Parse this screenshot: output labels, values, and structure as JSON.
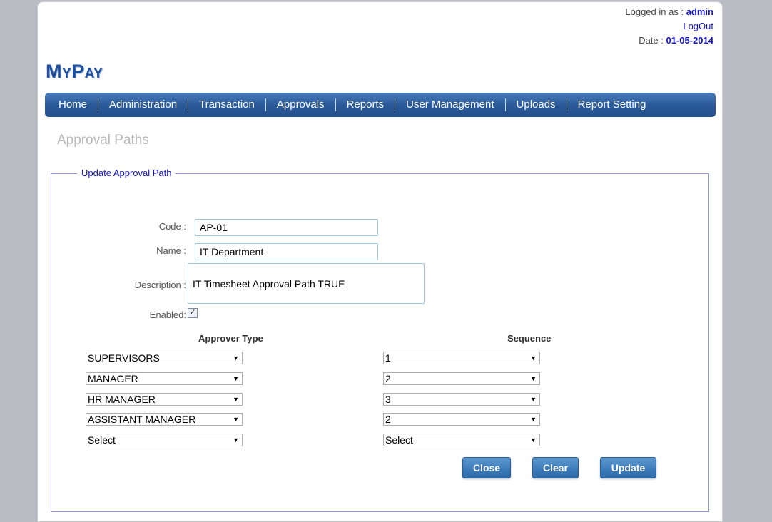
{
  "header": {
    "logged_in_label": "Logged in as :",
    "username": "admin",
    "logout": "LogOut",
    "date_label": "Date :",
    "date_value": "01-05-2014",
    "logo": "MyPay"
  },
  "nav": {
    "items": [
      "Home",
      "Administration",
      "Transaction",
      "Approvals",
      "Reports",
      "User Management",
      "Uploads",
      "Report Setting"
    ]
  },
  "page": {
    "title": "Approval Paths"
  },
  "form": {
    "legend": "Update Approval Path",
    "code_label": "Code :",
    "code_value": "AP-01",
    "name_label": "Name :",
    "name_value": "IT Department",
    "description_label": "Description :",
    "description_value": "IT Timesheet Approval Path TRUE",
    "enabled_label": "Enabled:",
    "enabled": true,
    "approver_type_header": "Approver Type",
    "sequence_header": "Sequence",
    "rows": [
      {
        "approver": "SUPERVISORS",
        "sequence": "1"
      },
      {
        "approver": "MANAGER",
        "sequence": "2"
      },
      {
        "approver": "HR MANAGER",
        "sequence": "3"
      },
      {
        "approver": "ASSISTANT MANAGER",
        "sequence": "2"
      },
      {
        "approver": "Select",
        "sequence": "Select"
      }
    ],
    "buttons": {
      "close": "Close",
      "clear": "Clear",
      "update": "Update"
    }
  },
  "colors": {
    "nav_bg": "#2b5a9a",
    "accent_text": "#1515c8",
    "button_bg": "#3a79b8"
  },
  "icons": {
    "dropdown": "chevron-down-icon",
    "checkbox": "checkmark-icon"
  }
}
